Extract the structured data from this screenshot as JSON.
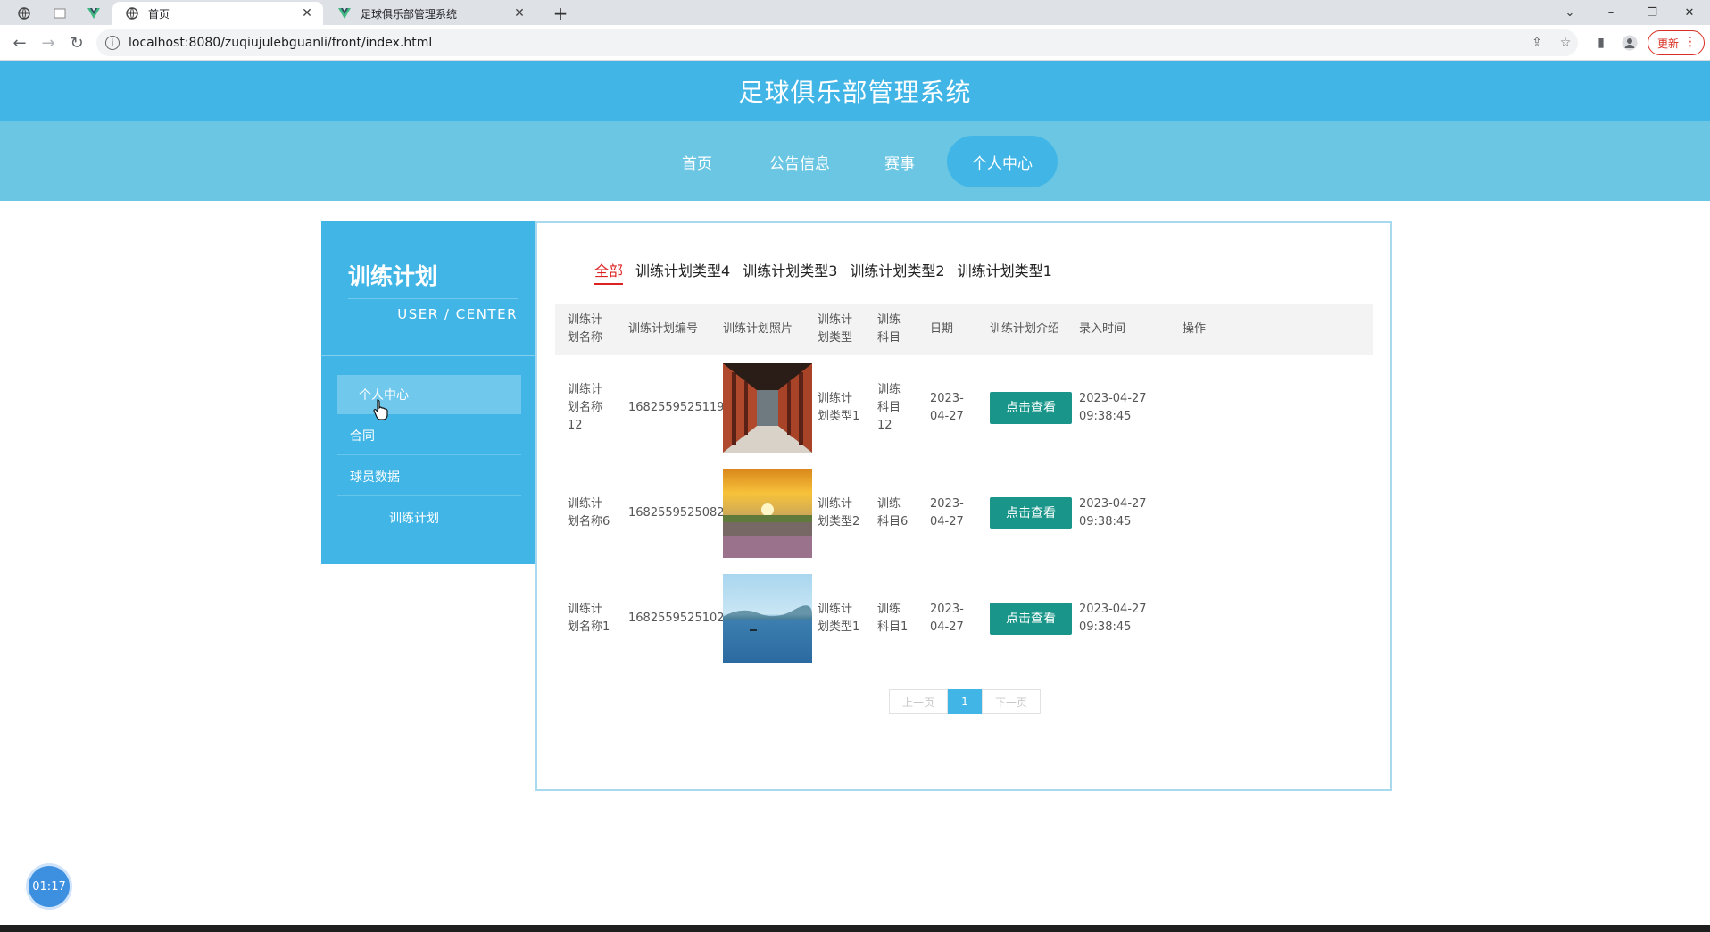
{
  "browser": {
    "tabs": [
      {
        "title": "首页",
        "icon": "globe-icon"
      },
      {
        "title": "足球俱乐部管理系统",
        "icon": "vue-icon"
      }
    ],
    "address": "localhost:8080/zuqiujulebguanli/front/index.html",
    "update_label": "更新"
  },
  "site": {
    "title": "足球俱乐部管理系统",
    "nav": [
      "首页",
      "公告信息",
      "赛事",
      "个人中心"
    ]
  },
  "sidebar": {
    "title": "训练计划",
    "subtitle": "USER / CENTER",
    "items": [
      "个人中心",
      "合同",
      "球员数据",
      "训练计划"
    ]
  },
  "filters": [
    "全部",
    "训练计划类型4",
    "训练计划类型3",
    "训练计划类型2",
    "训练计划类型1"
  ],
  "table": {
    "headers": [
      "训练计\n划名称",
      "训练计划编号",
      "训练计划照片",
      "训练计\n划类型",
      "训练\n科目",
      "日期",
      "训练计划介绍",
      "录入时间",
      "操作"
    ],
    "rows": [
      {
        "name": "训练计\n划名称\n12",
        "code": "1682559525119",
        "photo": "corridor-photo",
        "type": "训练计\n划类型1",
        "subject": "训练\n科目\n12",
        "date": "2023-\n04-27",
        "intro_button": "点击查看",
        "created": "2023-04-27\n09:38:45"
      },
      {
        "name": "训练计\n划名称6",
        "code": "1682559525082",
        "photo": "sunset-field-photo",
        "type": "训练计\n划类型2",
        "subject": "训练\n科目6",
        "date": "2023-\n04-27",
        "intro_button": "点击查看",
        "created": "2023-04-27\n09:38:45"
      },
      {
        "name": "训练计\n划名称1",
        "code": "1682559525102",
        "photo": "lake-photo",
        "type": "训练计\n划类型1",
        "subject": "训练\n科目1",
        "date": "2023-\n04-27",
        "intro_button": "点击查看",
        "created": "2023-04-27\n09:38:45"
      }
    ]
  },
  "pagination": {
    "prev": "上一页",
    "current": "1",
    "next": "下一页"
  },
  "timer": "01:17"
}
